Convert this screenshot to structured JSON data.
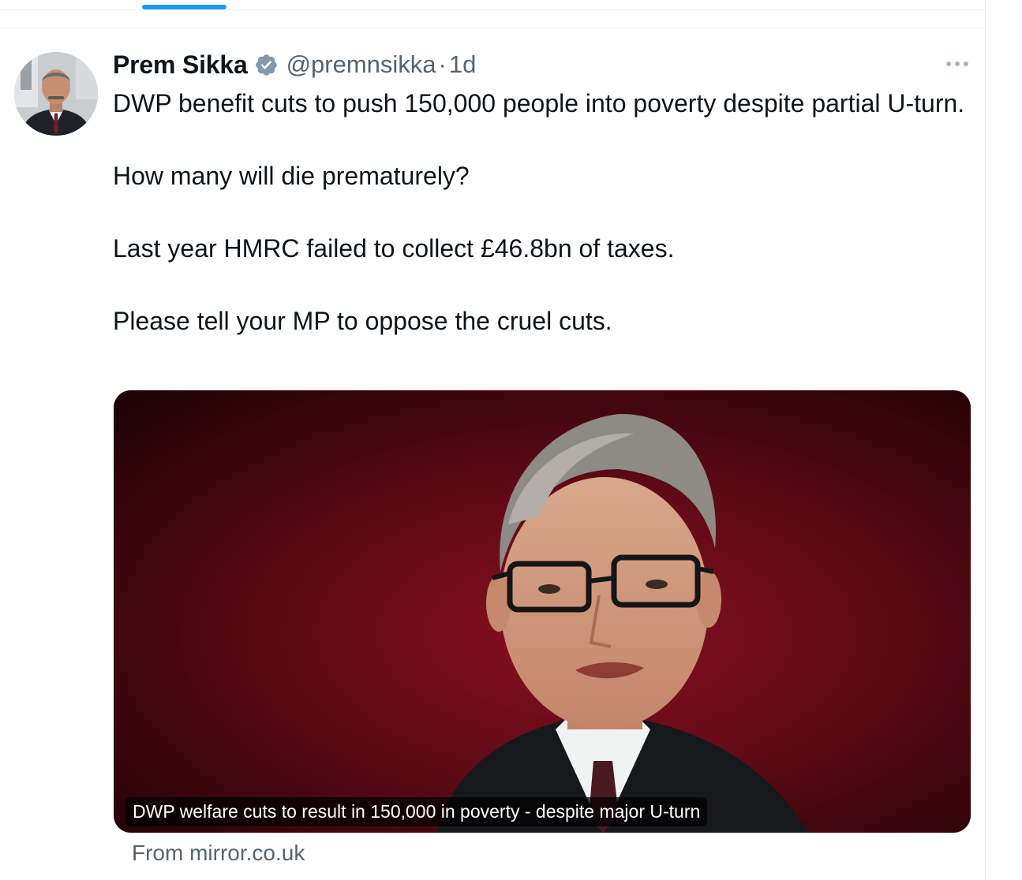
{
  "post": {
    "author": {
      "display_name": "Prem Sikka",
      "handle": "@premnsikka",
      "verified": true
    },
    "separator": "·",
    "time": "1d",
    "text_lines": [
      "DWP benefit cuts to push 150,000 people into poverty despite partial U-turn.",
      "How many will die prematurely?",
      "Last year HMRC failed to collect £46.8bn of taxes.",
      "Please tell your MP to oppose the cruel cuts."
    ],
    "card": {
      "headline": "DWP welfare cuts to result in 150,000 in poverty - despite major U-turn",
      "source": "From mirror.co.uk"
    }
  },
  "icons": {
    "verified": "verified-badge-icon",
    "more": "more-options-icon"
  },
  "colors": {
    "accent": "#1d9bf0",
    "secondary_text": "#536471",
    "primary_text": "#0f1419",
    "card_background": "#5b0913"
  }
}
